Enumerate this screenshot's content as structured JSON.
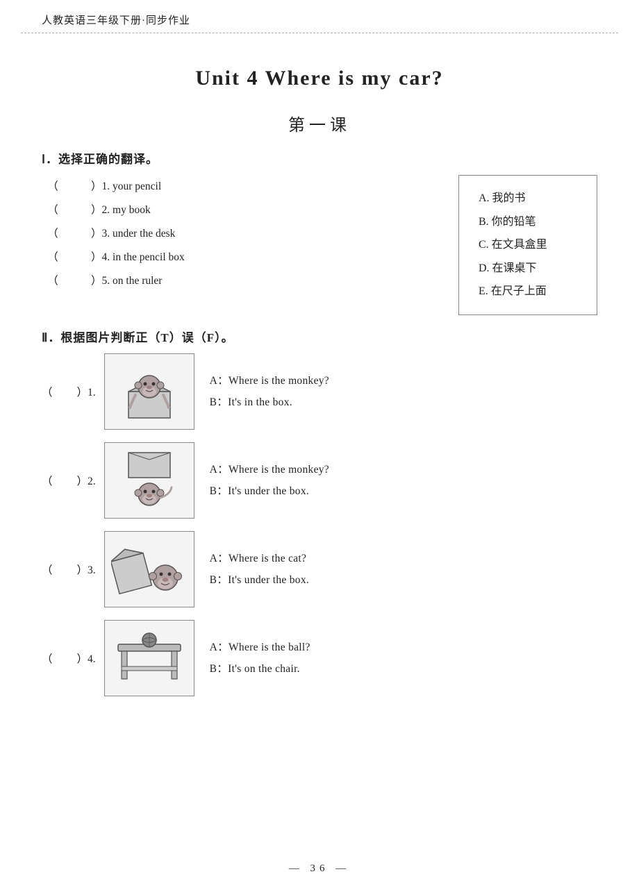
{
  "header": {
    "text": "人教英语三年级下册·同步作业"
  },
  "main_title": "Unit 4    Where is my car?",
  "lesson_title": "第一课",
  "section_I": {
    "title": "Ⅰ．选择正确的翻译。",
    "items": [
      {
        "num": "1",
        "text": "your pencil"
      },
      {
        "num": "2",
        "text": "my book"
      },
      {
        "num": "3",
        "text": "under the desk"
      },
      {
        "num": "4",
        "text": "in the pencil box"
      },
      {
        "num": "5",
        "text": "on the ruler"
      }
    ],
    "answers": [
      "A. 我的书",
      "B. 你的铅笔",
      "C. 在文具盒里",
      "D. 在课桌下",
      "E. 在尺子上面"
    ]
  },
  "section_II": {
    "title": "Ⅱ．根据图片判断正（T）误（F）。",
    "items": [
      {
        "num": "1",
        "dialogue_a": "A：Where is the monkey?",
        "dialogue_b": "B：It's in the box.",
        "img_desc": "monkey-in-box"
      },
      {
        "num": "2",
        "dialogue_a": "A：Where is the monkey?",
        "dialogue_b": "B：It's under the box.",
        "img_desc": "monkey-under-box"
      },
      {
        "num": "3",
        "dialogue_a": "A：Where is the cat?",
        "dialogue_b": "B：It's under the box.",
        "img_desc": "monkey-next-to-box"
      },
      {
        "num": "4",
        "dialogue_a": "A：Where is the ball?",
        "dialogue_b": "B：It's on the chair.",
        "img_desc": "desk-with-ball"
      }
    ]
  },
  "page_number": "— 36 —"
}
